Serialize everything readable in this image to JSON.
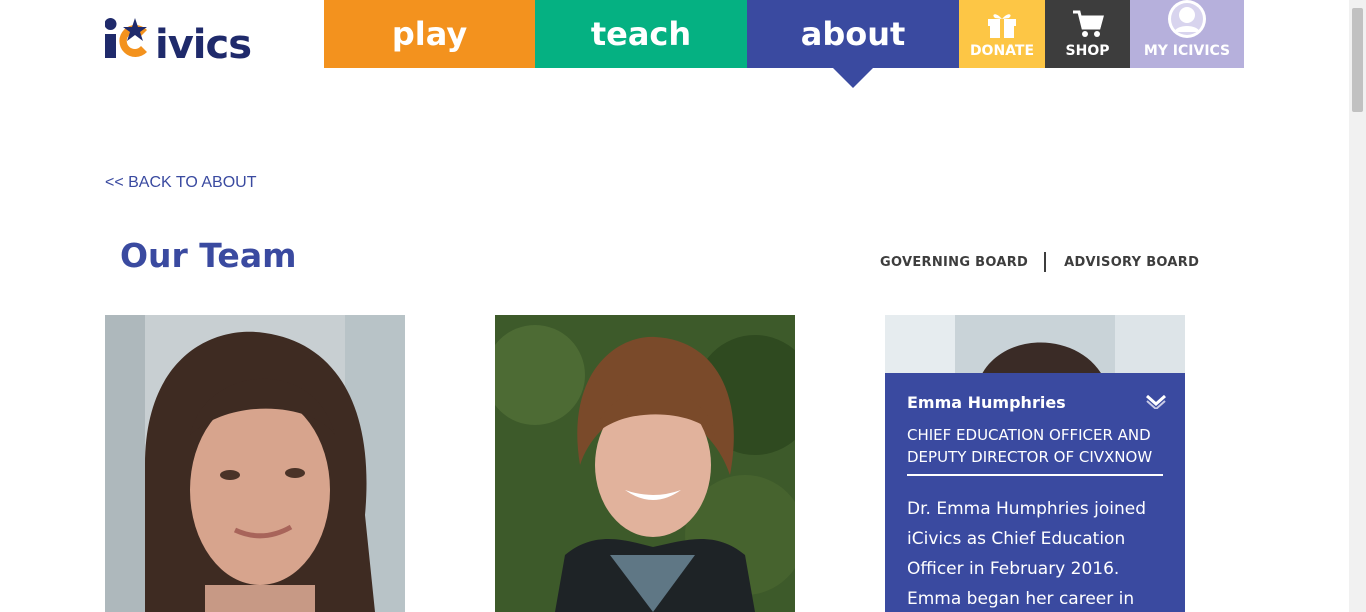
{
  "brand": {
    "logo_text": "iCivics"
  },
  "nav": {
    "play": "play",
    "teach": "teach",
    "about": "about",
    "donate": "DONATE",
    "shop": "SHOP",
    "my_icivics": "MY ICIVICS"
  },
  "back_link": "<< BACK TO ABOUT",
  "page_title": "Our Team",
  "board_links": {
    "governing": "GOVERNING BOARD",
    "advisory": "ADVISORY BOARD"
  },
  "team": [
    {
      "photo": "woman-dark-hair-portrait"
    },
    {
      "photo": "woman-short-brown-hair-portrait"
    },
    {
      "photo": "woman-dark-hair-portrait-partial",
      "name": "Emma Humphries",
      "role": "CHIEF EDUCATION OFFICER AND DEPUTY DIRECTOR OF CIVXNOW",
      "bio": "Dr. Emma Humphries joined iCivics as Chief Education Officer in February 2016. Emma began her career in"
    }
  ],
  "colors": {
    "play": "#f3921e",
    "teach": "#05b182",
    "about": "#3a4aa0",
    "donate": "#fdc645",
    "shop": "#3d3d3d",
    "my_icivics": "#b6b0dc",
    "brand_navy": "#1f2a6b"
  },
  "icons": [
    "gift-icon",
    "cart-icon",
    "avatar-icon",
    "chevron-down-icon",
    "star-icon"
  ]
}
